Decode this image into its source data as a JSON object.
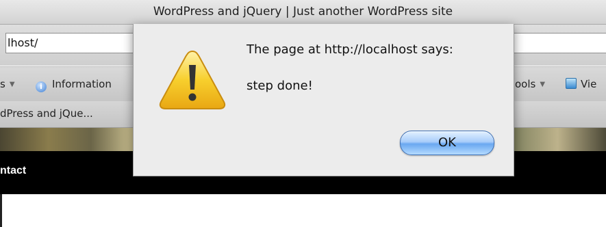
{
  "window": {
    "title": "WordPress and jQuery | Just another WordPress site"
  },
  "address_bar": {
    "value": "lhost/"
  },
  "toolbar": {
    "items": [
      {
        "label": "s"
      },
      {
        "label": "Information",
        "icon": "info-icon"
      },
      {
        "label": "ools"
      },
      {
        "label": "Vie",
        "icon": "view-icon"
      }
    ]
  },
  "bookmarks": {
    "tab_label": "dPress and jQue..."
  },
  "page": {
    "nav_label": "ntact"
  },
  "dialog": {
    "icon": "warning-icon",
    "message_origin": "The page at http://localhost says:",
    "message": "step done!",
    "ok_label": "OK"
  },
  "colors": {
    "dialog_bg": "#ececec",
    "ok_button": "#8fbff5",
    "warning_yellow": "#f4c21d",
    "nav_bg": "#000000"
  }
}
